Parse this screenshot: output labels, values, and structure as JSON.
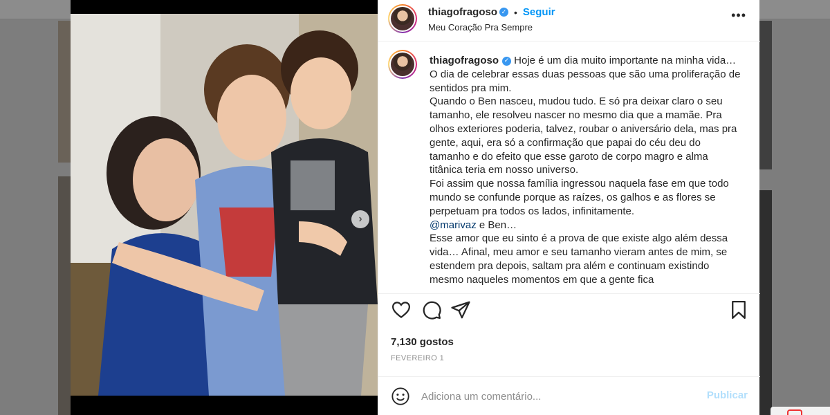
{
  "post": {
    "username": "thiagofragoso",
    "verified": true,
    "follow_label": "Seguir",
    "separator": "•",
    "location": "Meu Coração Pra Sempre",
    "more_icon": "more-horizontal-icon",
    "carousel": {
      "current": 1,
      "total": 2
    }
  },
  "caption": {
    "paragraphs": [
      "Hoje é um dia muito importante na minha vida… O dia de celebrar essas duas pessoas que são uma proliferação de sentidos pra mim.",
      "Quando o Ben nasceu, mudou tudo. E só pra deixar claro o seu tamanho, ele resolveu nascer no mesmo dia que a mamãe. Pra olhos exteriores poderia, talvez, roubar o aniversário dela, mas pra gente, aqui, era só a confirmação que papai do céu deu do tamanho e do efeito que esse garoto de corpo magro e alma titânica teria em nosso universo.",
      "Foi assim que nossa família ingressou naquela fase em que todo mundo se confunde porque as raízes, os galhos e as flores se perpetuam pra todos os lados, infinitamente."
    ],
    "mention": "@marivaz",
    "mention_suffix": " e Ben…",
    "closing": "Esse amor que eu sinto é a prova de que existe algo além dessa vida… Afinal, meu amor e seu tamanho vieram antes de mim, se estendem pra depois, saltam pra além e continuam existindo mesmo naqueles momentos em que a gente fica"
  },
  "stats": {
    "likes": "7,130 gostos",
    "date": "FEVEREIRO 1"
  },
  "comment": {
    "placeholder": "Adiciona um comentário...",
    "publish_label": "Publicar"
  },
  "colors": {
    "accent": "#0095f6",
    "verified": "#3897f0",
    "publish_disabled": "#b2dffc",
    "mention": "#00376b"
  }
}
